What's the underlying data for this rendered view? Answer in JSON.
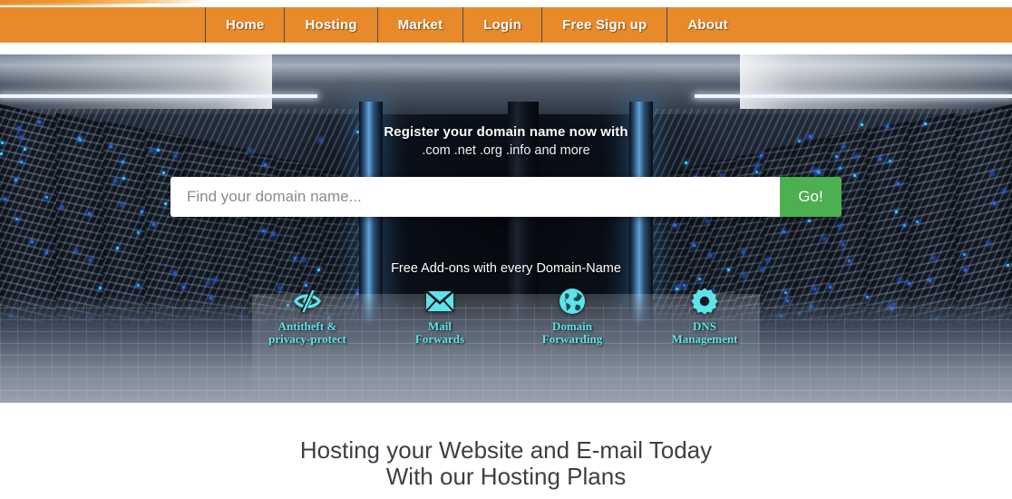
{
  "brand": {
    "accent_orange": "#e8892a",
    "accent_green": "#4caf50",
    "addon_cyan": "#5ee4e8",
    "heading_gray": "#3e3e46"
  },
  "navbar": {
    "items": [
      {
        "label": "Home",
        "name": "nav-item-home"
      },
      {
        "label": "Hosting",
        "name": "nav-item-hosting"
      },
      {
        "label": "Market",
        "name": "nav-item-market"
      },
      {
        "label": "Login",
        "name": "nav-item-login"
      },
      {
        "label": "Free Sign up",
        "name": "nav-item-free-sign-up"
      },
      {
        "label": "About",
        "name": "nav-item-about"
      }
    ]
  },
  "hero": {
    "title": "Register your domain name now with",
    "subtitle": ".com .net .org .info and more",
    "search": {
      "placeholder": "Find your domain name...",
      "value": "",
      "button_label": "Go!"
    },
    "addons_title": "Free Add-ons with every Domain-Name",
    "addons": [
      {
        "icon": "eye-slash-icon",
        "label": "Antitheft  &\nprivacy-protect"
      },
      {
        "icon": "envelope-icon",
        "label": "Mail\nForwards"
      },
      {
        "icon": "globe-icon",
        "label": "Domain\nForwarding"
      },
      {
        "icon": "gear-icon",
        "label": "DNS\nManagement"
      }
    ]
  },
  "below": {
    "heading": "Hosting your Website and E-mail Today\nWith our Hosting Plans"
  }
}
